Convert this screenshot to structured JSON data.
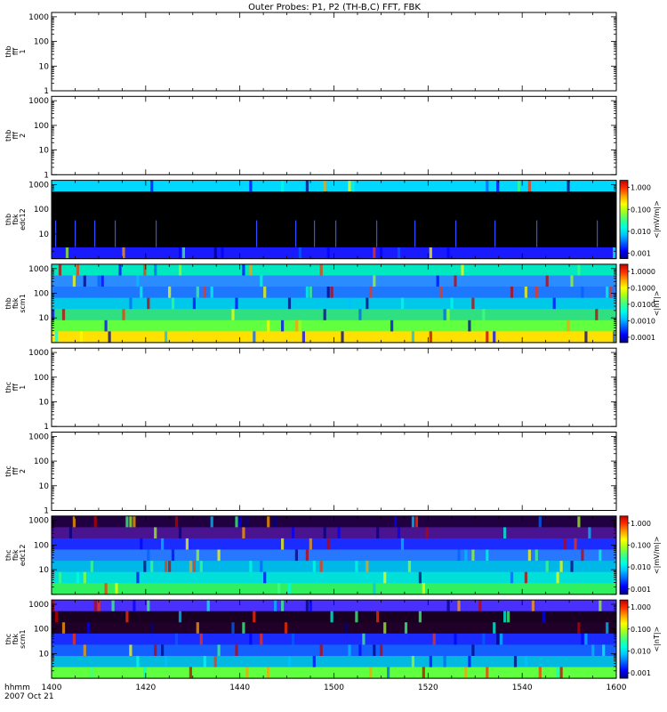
{
  "title": "Outer Probes: P1, P2 (TH-B,C) FFT, FBK",
  "x_axis": {
    "label_line1": "hhmm",
    "label_line2": "2007 Oct 21",
    "ticks": [
      "1400",
      "1420",
      "1440",
      "1500",
      "1520",
      "1540",
      "1600"
    ]
  },
  "chart_data": [
    {
      "type": "line",
      "ylabel": [
        "thb",
        "fff",
        "1"
      ],
      "yscale": "log",
      "ylim": [
        1,
        1500
      ],
      "yticks": [
        "1000",
        "100",
        "10",
        "1"
      ],
      "empty": true
    },
    {
      "type": "line",
      "ylabel": [
        "thb",
        "fff",
        "2"
      ],
      "yscale": "log",
      "ylim": [
        1,
        1500
      ],
      "yticks": [
        "1000",
        "100",
        "10",
        "1"
      ],
      "empty": true
    },
    {
      "type": "heatmap",
      "ylabel": [
        "thb",
        "fbk",
        "edc12"
      ],
      "yscale": "log",
      "yticks": [
        "1000",
        "100",
        "10"
      ],
      "colorbar": {
        "label": "<|mV/m|>",
        "ticks": [
          "1.000",
          "0.100",
          "0.010",
          "0.001"
        ]
      },
      "bands_dominant_color": [
        "#00d8ff",
        "#000000",
        "#000000",
        "#000000",
        "#000000",
        "#000000",
        "#1a1aff"
      ]
    },
    {
      "type": "heatmap",
      "ylabel": [
        "thb",
        "fbk",
        "scm1"
      ],
      "yscale": "log",
      "yticks": [
        "1000",
        "100",
        "10"
      ],
      "colorbar": {
        "label": "<|nT|>",
        "ticks": [
          "1.0000",
          "0.1000",
          "0.0100",
          "0.0010",
          "0.0001"
        ]
      },
      "bands_dominant_color": [
        "#00e8c0",
        "#2a8cff",
        "#1e78ff",
        "#00c8e8",
        "#30e080",
        "#60ff40",
        "#ffe000"
      ]
    },
    {
      "type": "line",
      "ylabel": [
        "thc",
        "fff",
        "1"
      ],
      "yscale": "log",
      "ylim": [
        1,
        1500
      ],
      "yticks": [
        "1000",
        "100",
        "10",
        "1"
      ],
      "empty": true
    },
    {
      "type": "line",
      "ylabel": [
        "thc",
        "fff",
        "2"
      ],
      "yscale": "log",
      "ylim": [
        1,
        1500
      ],
      "yticks": [
        "1000",
        "100",
        "10",
        "1"
      ],
      "empty": true
    },
    {
      "type": "heatmap",
      "ylabel": [
        "thc",
        "fbk",
        "edc12"
      ],
      "yscale": "log",
      "yticks": [
        "1000",
        "100",
        "10"
      ],
      "colorbar": {
        "label": "<|mV/m|>",
        "ticks": [
          "1.000",
          "0.100",
          "0.010",
          "0.001"
        ]
      },
      "bands_dominant_color": [
        "#200040",
        "#4a1490",
        "#1a2cff",
        "#2878ff",
        "#00b8e8",
        "#00e0d8",
        "#30f060"
      ]
    },
    {
      "type": "heatmap",
      "ylabel": [
        "thc",
        "fbk",
        "scm1"
      ],
      "yscale": "log",
      "yticks": [
        "1000",
        "100",
        "10"
      ],
      "colorbar": {
        "label": "<|nT|>",
        "ticks": [
          "1.000",
          "0.100",
          "0.010",
          "0.001"
        ]
      },
      "bands_dominant_color": [
        "#4a30ff",
        "#1a0020",
        "#200028",
        "#1a2cff",
        "#1460ff",
        "#00b8e0",
        "#60ff40"
      ]
    }
  ]
}
